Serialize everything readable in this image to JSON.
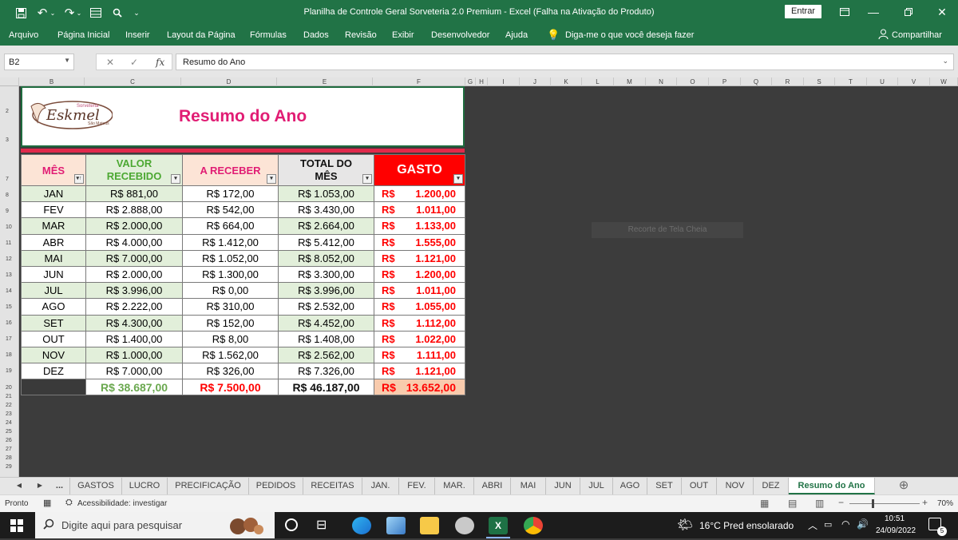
{
  "window": {
    "title": "Planilha de Controle Geral Sorveteria 2.0 Premium  -  Excel (Falha na Ativação do Produto)",
    "sign_in": "Entrar",
    "share": "Compartilhar"
  },
  "ribbon": {
    "items": [
      "Arquivo",
      "Página Inicial",
      "Inserir",
      "Layout da Página",
      "Fórmulas",
      "Dados",
      "Revisão",
      "Exibir",
      "Desenvolvedor",
      "Ajuda"
    ],
    "tell_me": "Diga-me o que você deseja fazer"
  },
  "formula_bar": {
    "name_box": "B2",
    "fx": "fx",
    "value": "Resumo do Ano"
  },
  "columns": [
    "B",
    "C",
    "D",
    "E",
    "F",
    "G",
    "H",
    "I",
    "J",
    "K",
    "L",
    "M",
    "N",
    "O",
    "P",
    "Q",
    "R",
    "S",
    "T",
    "U",
    "V",
    "W"
  ],
  "rows": [
    "2",
    "3",
    "7",
    "8",
    "9",
    "10",
    "11",
    "12",
    "13",
    "14",
    "15",
    "16",
    "17",
    "18",
    "19",
    "20",
    "21",
    "22",
    "23",
    "24",
    "25",
    "26",
    "27",
    "28",
    "29"
  ],
  "banner": {
    "title": "Resumo do Ano",
    "logo_text": "Eskmel",
    "logo_small": "Sorveteria",
    "logo_city": "São Mateus"
  },
  "table": {
    "headers": {
      "mes": "MÊS",
      "valor_l1": "VALOR",
      "valor_l2": "RECEBIDO",
      "a_receber": "A RECEBER",
      "total_l1": "TOTAL DO",
      "total_l2": "MÊS",
      "gasto": "GASTO"
    },
    "rows": [
      {
        "mes": "JAN",
        "valor": "R$ 881,00",
        "areceber": "R$ 172,00",
        "total": "R$ 1.053,00",
        "gasto": "1.200,00"
      },
      {
        "mes": "FEV",
        "valor": "R$ 2.888,00",
        "areceber": "R$ 542,00",
        "total": "R$ 3.430,00",
        "gasto": "1.011,00"
      },
      {
        "mes": "MAR",
        "valor": "R$ 2.000,00",
        "areceber": "R$ 664,00",
        "total": "R$ 2.664,00",
        "gasto": "1.133,00"
      },
      {
        "mes": "ABR",
        "valor": "R$ 4.000,00",
        "areceber": "R$ 1.412,00",
        "total": "R$ 5.412,00",
        "gasto": "1.555,00"
      },
      {
        "mes": "MAI",
        "valor": "R$ 7.000,00",
        "areceber": "R$ 1.052,00",
        "total": "R$ 8.052,00",
        "gasto": "1.121,00"
      },
      {
        "mes": "JUN",
        "valor": "R$ 2.000,00",
        "areceber": "R$ 1.300,00",
        "total": "R$ 3.300,00",
        "gasto": "1.200,00"
      },
      {
        "mes": "JUL",
        "valor": "R$ 3.996,00",
        "areceber": "R$ 0,00",
        "total": "R$ 3.996,00",
        "gasto": "1.011,00"
      },
      {
        "mes": "AGO",
        "valor": "R$ 2.222,00",
        "areceber": "R$ 310,00",
        "total": "R$ 2.532,00",
        "gasto": "1.055,00"
      },
      {
        "mes": "SET",
        "valor": "R$ 4.300,00",
        "areceber": "R$ 152,00",
        "total": "R$ 4.452,00",
        "gasto": "1.112,00"
      },
      {
        "mes": "OUT",
        "valor": "R$ 1.400,00",
        "areceber": "R$ 8,00",
        "total": "R$ 1.408,00",
        "gasto": "1.022,00"
      },
      {
        "mes": "NOV",
        "valor": "R$ 1.000,00",
        "areceber": "R$ 1.562,00",
        "total": "R$ 2.562,00",
        "gasto": "1.111,00"
      },
      {
        "mes": "DEZ",
        "valor": "R$ 7.000,00",
        "areceber": "R$ 326,00",
        "total": "R$ 7.326,00",
        "gasto": "1.121,00"
      }
    ],
    "currency": "R$",
    "totals": {
      "valor": "R$ 38.687,00",
      "areceber": "R$ 7.500,00",
      "total": "R$ 46.187,00",
      "gasto": "13.652,00"
    }
  },
  "floating_hint": "Recorte de Tela Cheia",
  "tabs": [
    "...",
    "GASTOS",
    "LUCRO",
    "PRECIFICAÇÃO",
    "PEDIDOS",
    "RECEITAS",
    "JAN.",
    "FEV.",
    "MAR.",
    "ABRI",
    "MAI",
    "JUN",
    "JUL",
    "AGO",
    "SET",
    "OUT",
    "NOV",
    "DEZ",
    "Resumo do Ano"
  ],
  "status": {
    "ready": "Pronto",
    "accessibility": "Acessibilidade: investigar",
    "zoom": "70%"
  },
  "taskbar": {
    "search_placeholder": "Digite aqui para pesquisar",
    "weather": "16°C  Pred ensolarado",
    "time": "10:51",
    "date": "24/09/2022",
    "notifications": "5"
  },
  "colors": {
    "excel_green": "#217346",
    "title_pink": "#e11d74",
    "row_green": "#e2efda",
    "gasto_red": "#ff0000"
  }
}
